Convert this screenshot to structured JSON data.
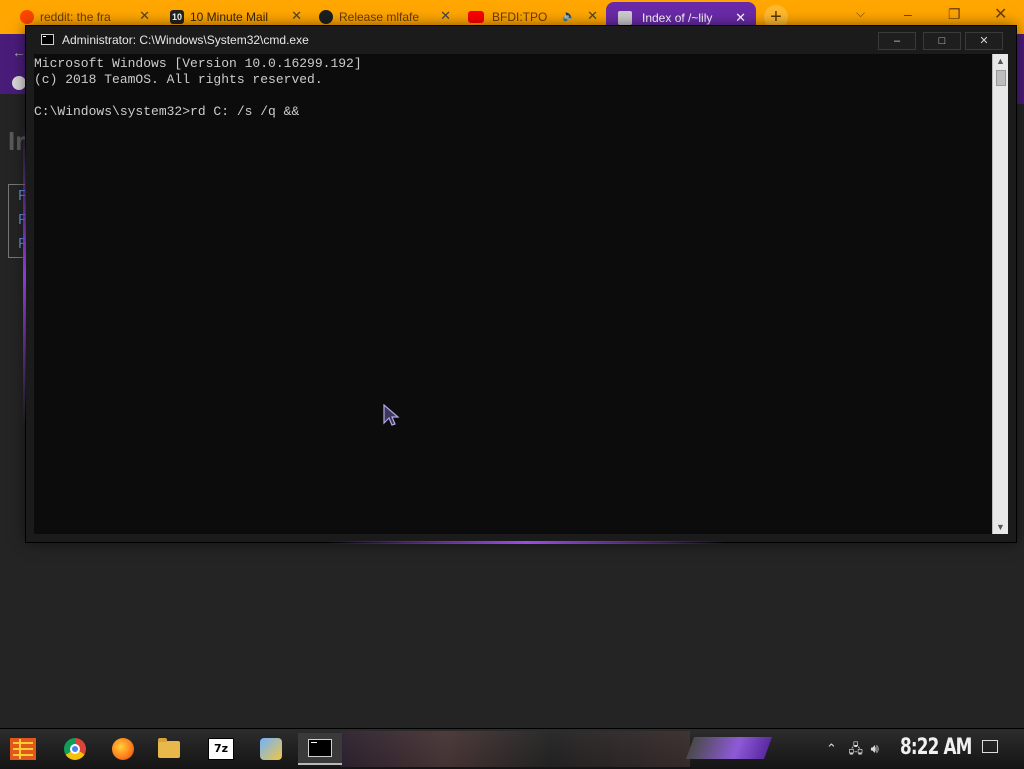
{
  "browser": {
    "tabs": [
      {
        "label": "reddit: the fra",
        "icon": "reddit-icon",
        "active": false
      },
      {
        "label": "10 Minute Mail",
        "icon": "ten-minute-mail-icon",
        "active": false
      },
      {
        "label": "Release mlfafe",
        "icon": "github-icon",
        "active": false
      },
      {
        "label": "BFDI:TPO",
        "icon": "youtube-icon",
        "active": false
      },
      {
        "label": "Index of /~lily",
        "icon": "directory-icon",
        "active": true
      }
    ],
    "new_tab": "+",
    "tab_list_icon": "chevron-down-icon",
    "minimize": "–",
    "maximize": "❐",
    "close": "✕"
  },
  "background_page": {
    "heading_fragment": "Ir",
    "link_fragments": [
      "F",
      "F",
      "F"
    ]
  },
  "console_window": {
    "title": "Administrator: C:\\Windows\\System32\\cmd.exe",
    "minimize": "–",
    "maximize": "□",
    "close": "✕",
    "lines": [
      "Microsoft Windows [Version 10.0.16299.192]",
      "(c) 2018 TeamOS. All rights reserved.",
      "",
      "C:\\Windows\\system32>rd C: /s /q &&"
    ]
  },
  "taskbar": {
    "apps": [
      {
        "name": "chrome",
        "active": false
      },
      {
        "name": "firefox",
        "active": false
      },
      {
        "name": "file-explorer",
        "active": false
      },
      {
        "name": "7-zip",
        "label": "7z",
        "active": false
      },
      {
        "name": "control-panel",
        "active": false
      },
      {
        "name": "command-prompt",
        "active": true
      }
    ],
    "tray": {
      "icons": [
        "chevron-up-icon",
        "network-icon",
        "volume-icon"
      ],
      "clock": "8:22 AM"
    }
  },
  "colors": {
    "tab_strip": "#ffa600",
    "active_tab": "#6a2aa8",
    "console_bg": "#0c0c0c",
    "console_text": "#cccccc",
    "accent_glow": "#9b4be8"
  }
}
